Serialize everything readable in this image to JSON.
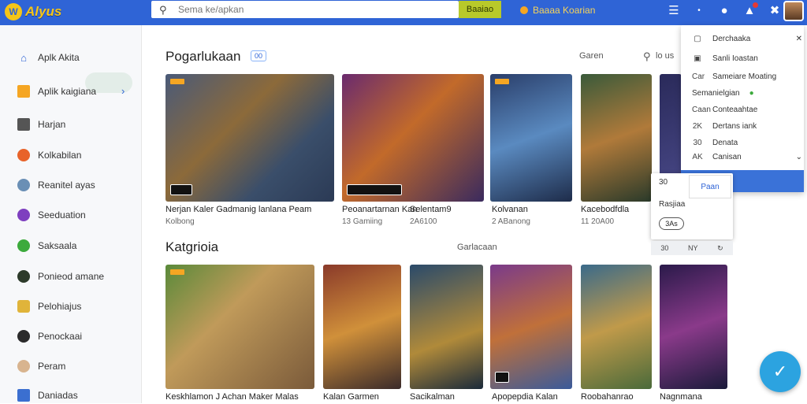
{
  "header": {
    "logo_text": "Alyus",
    "search_placeholder": "Sema ke/apkan",
    "search_button": "Baaiao",
    "promo_text": "Baaaa Koarian"
  },
  "sidebar": {
    "items": [
      {
        "label": "Aplk Akita",
        "icon": "home-icon"
      },
      {
        "label": "Aplik kaigiana",
        "icon": "folder-icon"
      },
      {
        "label": "Harjan",
        "icon": "briefcase-icon"
      },
      {
        "label": "Kolkabilan",
        "icon": "orange-app-icon"
      },
      {
        "label": "Reanitel ayas",
        "icon": "avatar-icon"
      },
      {
        "label": "Seeduation",
        "icon": "purple-app-icon"
      },
      {
        "label": "Saksaala",
        "icon": "green-app-icon"
      },
      {
        "label": "Ponieod amane",
        "icon": "game-icon"
      },
      {
        "label": "Pelohiajus",
        "icon": "yellow-app-icon"
      },
      {
        "label": "Penockaai",
        "icon": "dark-app-icon"
      },
      {
        "label": "Peram",
        "icon": "face-icon"
      },
      {
        "label": "Daniadas",
        "icon": "blue-app-icon"
      }
    ]
  },
  "sections": {
    "top_title": "Pogarlukaan",
    "top_tag": "00",
    "top_filter": "Garen",
    "top_filter_extra": "lo us",
    "cat_title": "Katgrioia",
    "cat_filter": "Garlacaan"
  },
  "top_cards": [
    {
      "title": "Nerjan Kaler Gadmanig lanlana Peam",
      "sub": "Kolbong"
    },
    {
      "title": "Peoanartarnan Kan",
      "sub": "13 Gamiing"
    },
    {
      "title": "Selentam9",
      "sub": "2A6100"
    },
    {
      "title": "Kolvanan",
      "sub": "2 ABanong"
    },
    {
      "title": "Kacebodfdla",
      "sub": "11 20A00"
    }
  ],
  "cat_cards": [
    {
      "title": "Keskhlamon J Achan Maker Malas"
    },
    {
      "title": "Kalan Garmen"
    },
    {
      "title": "Sacikalman"
    },
    {
      "title": "Apopepdia Kalan"
    },
    {
      "title": "Roobahanrao"
    },
    {
      "title": "Nagnmana"
    }
  ],
  "dropdown": {
    "items": [
      {
        "icon": "calendar-icon",
        "label": "Derchaaka"
      },
      {
        "icon": "image-icon",
        "label": "Sanli Ioastan"
      },
      {
        "icon": "text-icon",
        "icon_text": "Car",
        "label": "Sameiare Moating"
      },
      {
        "icon": "text-icon",
        "icon_text": "",
        "label": "Semanielgian"
      },
      {
        "icon": "text-icon",
        "icon_text": "Caan",
        "label": "Conteaahtae"
      },
      {
        "icon": "text-icon",
        "icon_text": "2K",
        "label": "Dertans iank"
      },
      {
        "icon": "text-icon",
        "icon_text": "30",
        "label": "Denata"
      },
      {
        "icon": "text-icon",
        "icon_text": "AK",
        "label": "Canisan"
      }
    ]
  },
  "popover": {
    "label_top": "30",
    "button": "Paan",
    "label_mid": "Rasjiaa",
    "pill": "3As",
    "tools": [
      "30",
      "NY"
    ]
  },
  "colors": {
    "topbar": "#2f64d6",
    "accent": "#f5c518",
    "search_button": "#b8c92a",
    "fab": "#2ca3e0"
  }
}
